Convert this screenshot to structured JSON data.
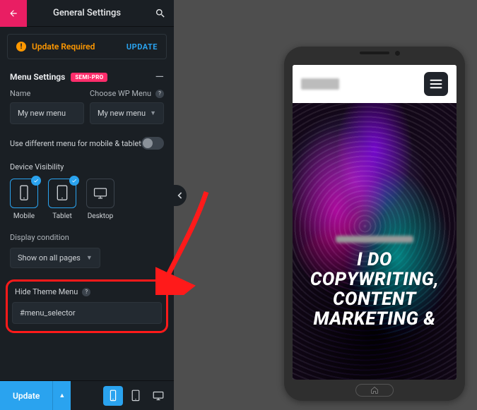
{
  "topbar": {
    "title": "General Settings"
  },
  "notice": {
    "text": "Update Required",
    "action": "UPDATE"
  },
  "menu_settings": {
    "title": "Menu Settings",
    "badge": "SEMI-PRO",
    "name_label": "Name",
    "name_value": "My new menu",
    "choose_label": "Choose WP Menu",
    "choose_value": "My new menu",
    "diff_menu_label": "Use different menu for mobile & tablet",
    "device_visibility_title": "Device Visibility",
    "devices": {
      "mobile": "Mobile",
      "tablet": "Tablet",
      "desktop": "Desktop"
    },
    "display_condition_label": "Display condition",
    "display_condition_value": "Show on all pages",
    "hide_theme_label": "Hide Theme Menu",
    "hide_theme_value": "#menu_selector"
  },
  "footer": {
    "update": "Update"
  },
  "preview": {
    "hero_text": "I DO COPYWRITING, CONTENT MARKETING &"
  }
}
